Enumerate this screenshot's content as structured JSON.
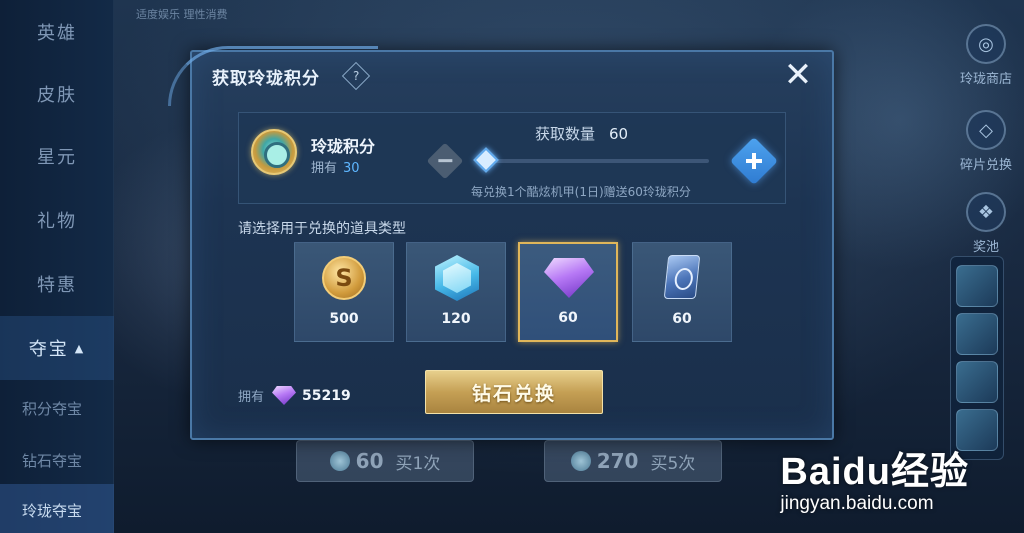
{
  "left_nav": {
    "items": [
      {
        "label": "英雄"
      },
      {
        "label": "皮肤"
      },
      {
        "label": "星元"
      },
      {
        "label": "礼物"
      },
      {
        "label": "特惠"
      },
      {
        "label": "夺宝"
      }
    ],
    "active_caret": "▲",
    "sub_items": [
      {
        "label": "积分夺宝"
      },
      {
        "label": "钻石夺宝"
      },
      {
        "label": "玲珑夺宝"
      }
    ]
  },
  "top_hint": "适度娱乐 理性消费",
  "right_nav": {
    "items": [
      {
        "label": "玲珑商店",
        "icon": "shop-icon"
      },
      {
        "label": "碎片兑换",
        "icon": "fragment-icon"
      },
      {
        "label": "奖池",
        "icon": "prize-pool-icon"
      }
    ]
  },
  "background_buttons": [
    {
      "amount": "60",
      "label": "买1次"
    },
    {
      "amount": "270",
      "label": "买5次"
    }
  ],
  "watermark": {
    "brand": "Bai",
    "brand_paw": "du",
    "brand_suffix": "经验",
    "url": "jingyan.baidu.com"
  },
  "modal": {
    "title": "获取玲珑积分",
    "help_symbol": "?",
    "close_symbol": "✕",
    "points": {
      "name": "玲珑积分",
      "owned_label": "拥有",
      "owned_value": "30"
    },
    "quantity": {
      "label": "获取数量",
      "value": "60",
      "slider_fraction": 0
    },
    "bonus_note": "每兑换1个酷炫机甲(1日)赠送60玲珑积分",
    "section_label": "请选择用于兑换的道具类型",
    "items": [
      {
        "name": "gold-coin",
        "qty": "500",
        "selected": false
      },
      {
        "name": "crystal",
        "qty": "120",
        "selected": false
      },
      {
        "name": "diamond",
        "qty": "60",
        "selected": true
      },
      {
        "name": "card",
        "qty": "60",
        "selected": false
      }
    ],
    "owned_bottom": {
      "label": "拥有",
      "amount": "55219"
    },
    "exchange_button": "钻石兑换"
  },
  "colors": {
    "accent_blue": "#4ea3ef",
    "gold": "#c5a055",
    "selected_border": "#e0b65a"
  }
}
